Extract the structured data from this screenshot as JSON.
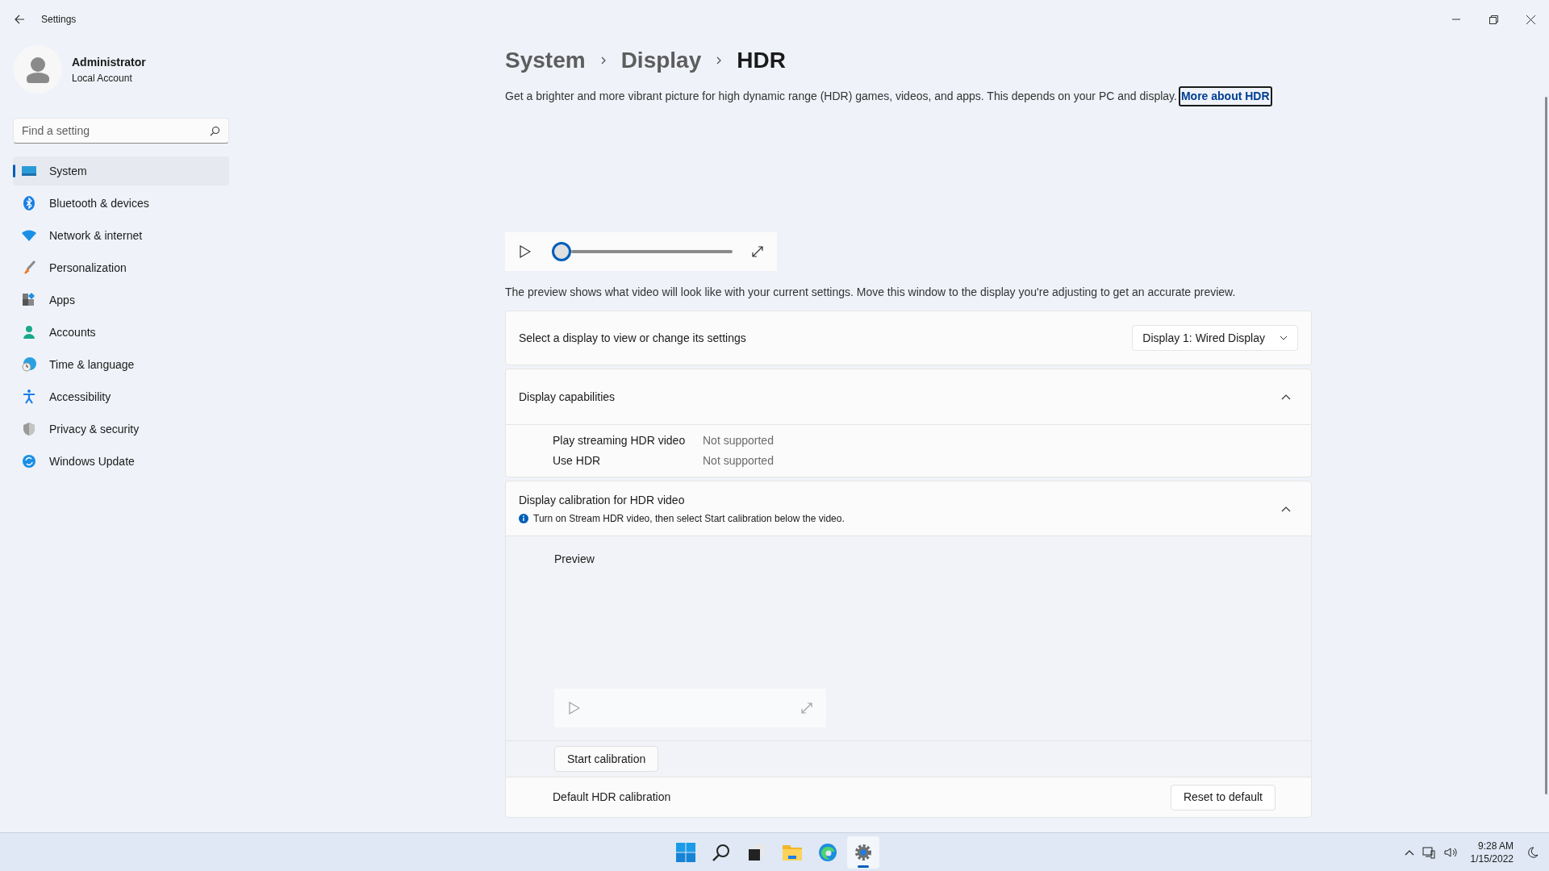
{
  "window": {
    "title": "Settings"
  },
  "account": {
    "name": "Administrator",
    "type": "Local Account"
  },
  "search": {
    "placeholder": "Find a setting"
  },
  "nav": [
    {
      "kind": "system",
      "label": "System",
      "selected": true
    },
    {
      "kind": "bluetooth",
      "label": "Bluetooth & devices",
      "selected": false
    },
    {
      "kind": "network",
      "label": "Network & internet",
      "selected": false
    },
    {
      "kind": "personalization",
      "label": "Personalization",
      "selected": false
    },
    {
      "kind": "apps",
      "label": "Apps",
      "selected": false
    },
    {
      "kind": "accounts",
      "label": "Accounts",
      "selected": false
    },
    {
      "kind": "time",
      "label": "Time & language",
      "selected": false
    },
    {
      "kind": "accessibility",
      "label": "Accessibility",
      "selected": false
    },
    {
      "kind": "privacy",
      "label": "Privacy & security",
      "selected": false
    },
    {
      "kind": "update",
      "label": "Windows Update",
      "selected": false
    }
  ],
  "breadcrumb": [
    "System",
    "Display",
    "HDR"
  ],
  "description": {
    "text": "Get a brighter and more vibrant picture for high dynamic range (HDR) games, videos, and apps. This depends on your PC and display.",
    "link": "More about HDR"
  },
  "player": {
    "disabled": false,
    "level": 0
  },
  "preview_note": "The preview shows what video will look like with your current settings. Move this window to the display you're adjusting to get an accurate preview.",
  "display_select": {
    "label": "Select a display to view or change its settings",
    "value": "Display 1: Wired Display"
  },
  "capabilities": {
    "title": "Display capabilities",
    "expanded": true,
    "rows": [
      {
        "name": "Play streaming HDR video",
        "value": "Not supported"
      },
      {
        "name": "Use HDR",
        "value": "Not supported"
      }
    ]
  },
  "calibration": {
    "title": "Display calibration for HDR video",
    "info": "Turn on Stream HDR video, then select Start calibration below the video.",
    "expanded": true,
    "preview_label": "Preview",
    "player": {
      "disabled": true
    },
    "start_button": "Start calibration",
    "default_label": "Default HDR calibration",
    "reset_button": "Reset to default"
  },
  "taskbar": [
    {
      "kind": "start",
      "selected": false
    },
    {
      "kind": "search",
      "selected": false
    },
    {
      "kind": "taskview",
      "selected": false
    },
    {
      "kind": "explorer",
      "selected": false
    },
    {
      "kind": "edge",
      "selected": false
    },
    {
      "kind": "settings",
      "selected": true
    }
  ],
  "tray": {
    "time": "9:28 AM",
    "date": "1/15/2022"
  }
}
